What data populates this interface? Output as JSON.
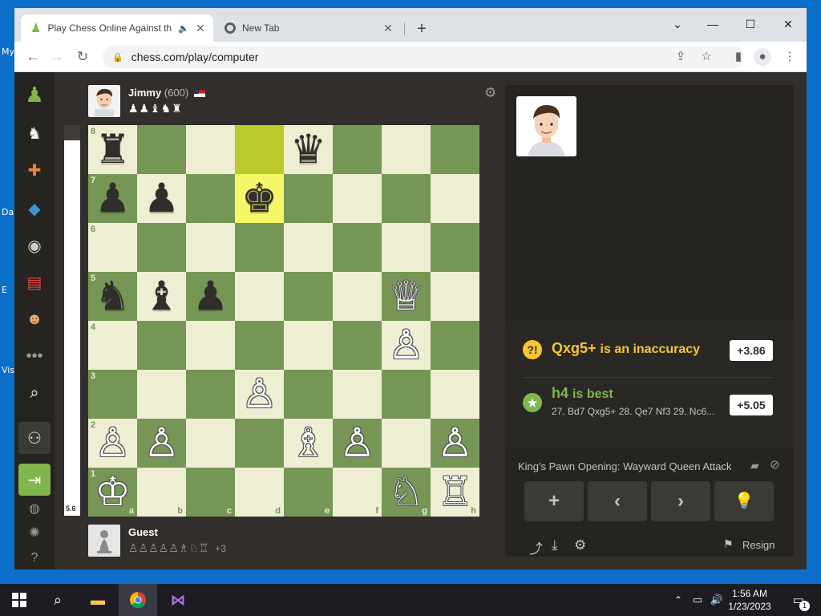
{
  "browser": {
    "tabs": [
      {
        "title": "Play Chess Online Against th",
        "icon": "chess-pawn-icon"
      },
      {
        "title": "New Tab",
        "icon": "chrome-icon"
      }
    ],
    "url": "chess.com/play/computer"
  },
  "player_top": {
    "name": "Jimmy",
    "rating": "(600)",
    "captured": "♟♟♝♞♜"
  },
  "player_bottom": {
    "name": "Guest",
    "captured": "♙♙♙♙♙♗♘♖",
    "advantage": "+3"
  },
  "eval_bar": {
    "value": "5.6",
    "white_fraction": 0.96
  },
  "board": {
    "files": [
      "a",
      "b",
      "c",
      "d",
      "e",
      "f",
      "g",
      "h"
    ],
    "ranks": [
      "8",
      "7",
      "6",
      "5",
      "4",
      "3",
      "2",
      "1"
    ],
    "highlight_from": "d8",
    "highlight_to": "d7",
    "pieces": [
      {
        "sq": "a8",
        "p": "♜",
        "c": "b"
      },
      {
        "sq": "e8",
        "p": "♛",
        "c": "b"
      },
      {
        "sq": "a7",
        "p": "♟",
        "c": "b"
      },
      {
        "sq": "b7",
        "p": "♟",
        "c": "b"
      },
      {
        "sq": "d7",
        "p": "♚",
        "c": "b"
      },
      {
        "sq": "a5",
        "p": "♞",
        "c": "b"
      },
      {
        "sq": "b5",
        "p": "♝",
        "c": "b"
      },
      {
        "sq": "c5",
        "p": "♟",
        "c": "b"
      },
      {
        "sq": "g5",
        "p": "♕",
        "c": "w"
      },
      {
        "sq": "g4",
        "p": "♙",
        "c": "w"
      },
      {
        "sq": "d3",
        "p": "♙",
        "c": "w"
      },
      {
        "sq": "a2",
        "p": "♙",
        "c": "w"
      },
      {
        "sq": "b2",
        "p": "♙",
        "c": "w"
      },
      {
        "sq": "e2",
        "p": "♗",
        "c": "w"
      },
      {
        "sq": "f2",
        "p": "♙",
        "c": "w"
      },
      {
        "sq": "h2",
        "p": "♙",
        "c": "w"
      },
      {
        "sq": "a1",
        "p": "♔",
        "c": "w"
      },
      {
        "sq": "g1",
        "p": "♘",
        "c": "w"
      },
      {
        "sq": "h1",
        "p": "♖",
        "c": "w"
      }
    ]
  },
  "coach": {
    "move_played": "Qxg5+",
    "move_verdict": "is an inaccuracy",
    "move_eval": "+3.86",
    "best_move": "h4",
    "best_verdict": "is best",
    "best_line": "27. Bd7 Qxg5+ 28. Qe7 Nf3 29. Nc6...",
    "best_eval": "+5.05"
  },
  "opening": "King's Pawn Opening: Wayward Queen Attack",
  "controls": {
    "resign_label": "Resign"
  },
  "taskbar": {
    "time": "1:56 AM",
    "date": "1/23/2023",
    "notif_count": "1"
  },
  "colors": {
    "light_square": "#eeeed2",
    "dark_square": "#769656",
    "accent_green": "#81b64c",
    "inaccuracy": "#f7c631"
  }
}
